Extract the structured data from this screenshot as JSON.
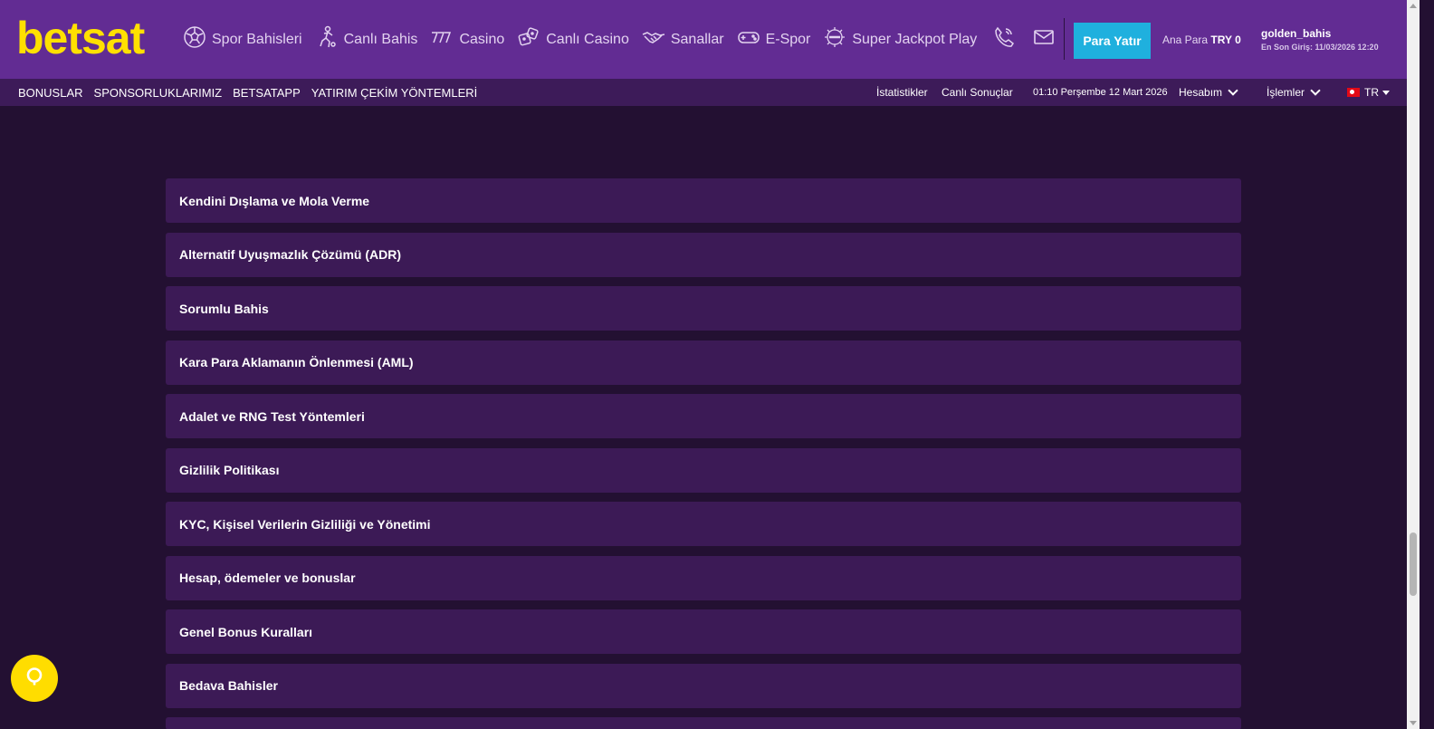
{
  "header": {
    "logo": "betsat",
    "nav": [
      {
        "label": "Spor Bahisleri",
        "icon": "soccer-ball-icon"
      },
      {
        "label": "Canlı Bahis",
        "icon": "player-icon"
      },
      {
        "label": "Casino",
        "icon": "slot-777-icon"
      },
      {
        "label": "Canlı Casino",
        "icon": "dice-icon"
      },
      {
        "label": "Sanallar",
        "icon": "handshake-icon"
      },
      {
        "label": "E-Spor",
        "icon": "gamepad-icon"
      },
      {
        "label": "Super Jackpot Play",
        "icon": "jackpot-icon"
      }
    ],
    "deposit_label": "Para Yatır",
    "balance_label": "Ana Para",
    "balance_value": "TRY 0",
    "username": "golden_bahis",
    "last_login": "En Son Giriş: 11/03/2026 12:20"
  },
  "subbar": {
    "links": [
      "BONUSLAR",
      "SPONSORLUKLARIMIZ",
      "BETSATAPP",
      "YATIRIM ÇEKİM YÖNTEMLERİ"
    ],
    "stats": "İstatistikler",
    "live_results": "Canlı Sonuçlar",
    "datetime": "01:10 Perşembe 12 Mart 2026",
    "account": "Hesabım",
    "transactions": "İşlemler",
    "language": "TR"
  },
  "list": [
    "Kendini Dışlama ve Mola Verme",
    "Alternatif Uyuşmazlık Çözümü (ADR)",
    "Sorumlu Bahis",
    "Kara Para Aklamanın Önlenmesi (AML)",
    "Adalet ve RNG Test Yöntemleri",
    "Gizlilik Politikası",
    "KYC, Kişisel Verilerin Gizliliği ve Yönetimi",
    "Hesap, ödemeler ve bonuslar",
    "Genel Bonus Kuralları",
    "Bedava Bahisler"
  ],
  "colors": {
    "header_bg": "#622c93",
    "subbar_bg": "#3d1b59",
    "page_bg": "#231032",
    "row_bg": "#3c1a56",
    "logo": "#ffe000",
    "deposit": "#1fb0de",
    "chat": "#ffdd00"
  }
}
